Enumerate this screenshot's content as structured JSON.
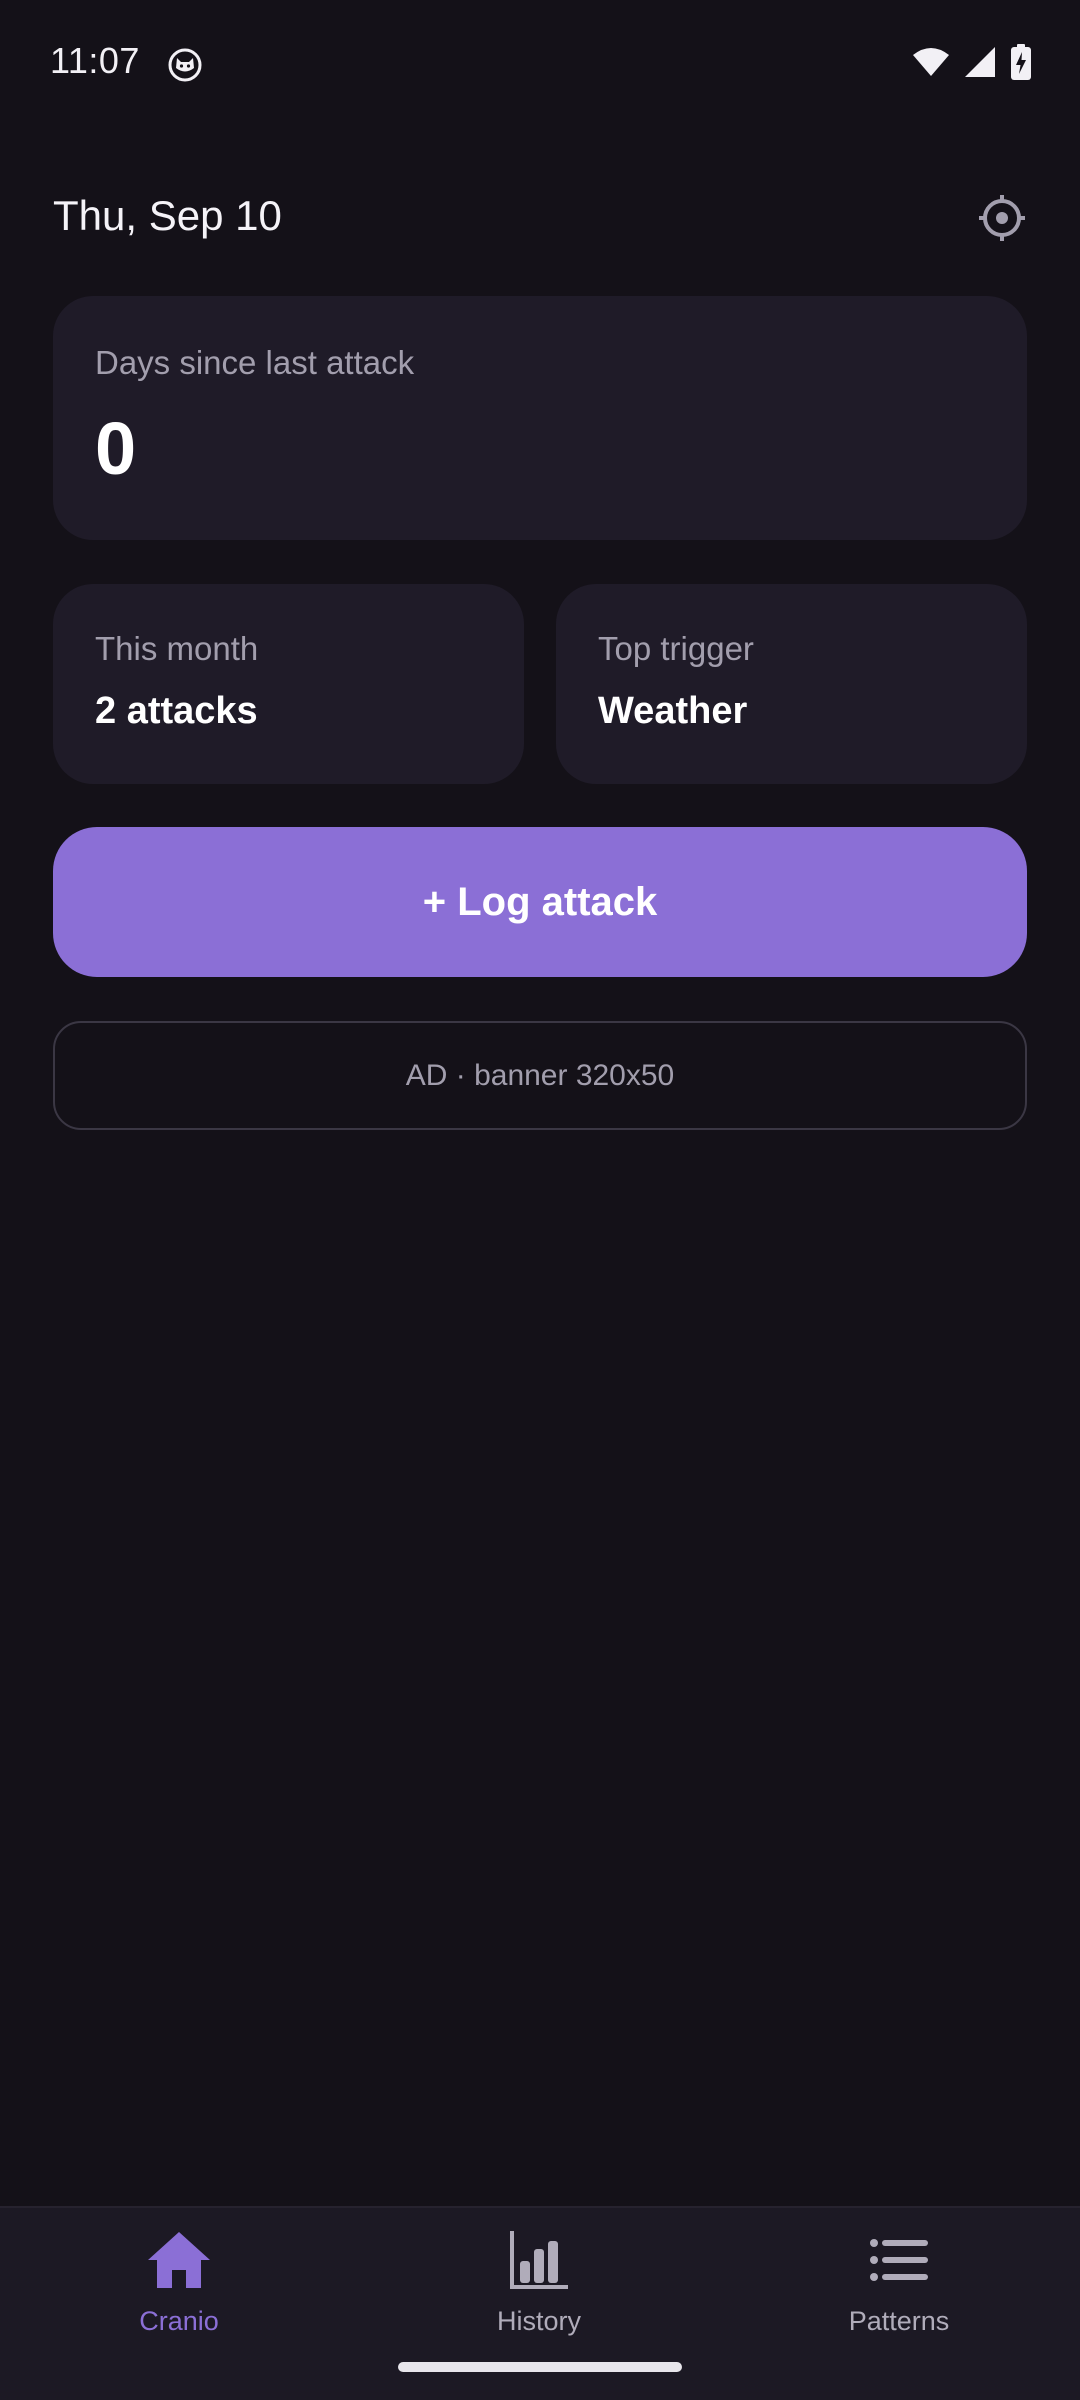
{
  "status_bar": {
    "time": "11:07",
    "app_icon": "cat-face-icon",
    "wifi_icon": "wifi-icon",
    "signal_icon": "cell-signal-icon",
    "battery_icon": "battery-charging-icon"
  },
  "header": {
    "date": "Thu, Sep 10",
    "settings_icon": "settings-icon"
  },
  "days_card": {
    "label": "Days since last attack",
    "value": "0"
  },
  "month_card": {
    "label": "This month",
    "value": "2 attacks"
  },
  "trigger_card": {
    "label": "Top trigger",
    "value": "Weather"
  },
  "log_button": {
    "label": "+ Log attack"
  },
  "ad": {
    "text": "AD · banner 320x50"
  },
  "nav": {
    "items": [
      {
        "label": "Cranio",
        "icon": "home-icon",
        "active": true
      },
      {
        "label": "History",
        "icon": "bar-chart-icon",
        "active": false
      },
      {
        "label": "Patterns",
        "icon": "list-icon",
        "active": false
      }
    ]
  },
  "colors": {
    "background": "#141118",
    "card": "#1f1b28",
    "accent": "#8b6fd6",
    "muted_text": "#a29ead"
  }
}
